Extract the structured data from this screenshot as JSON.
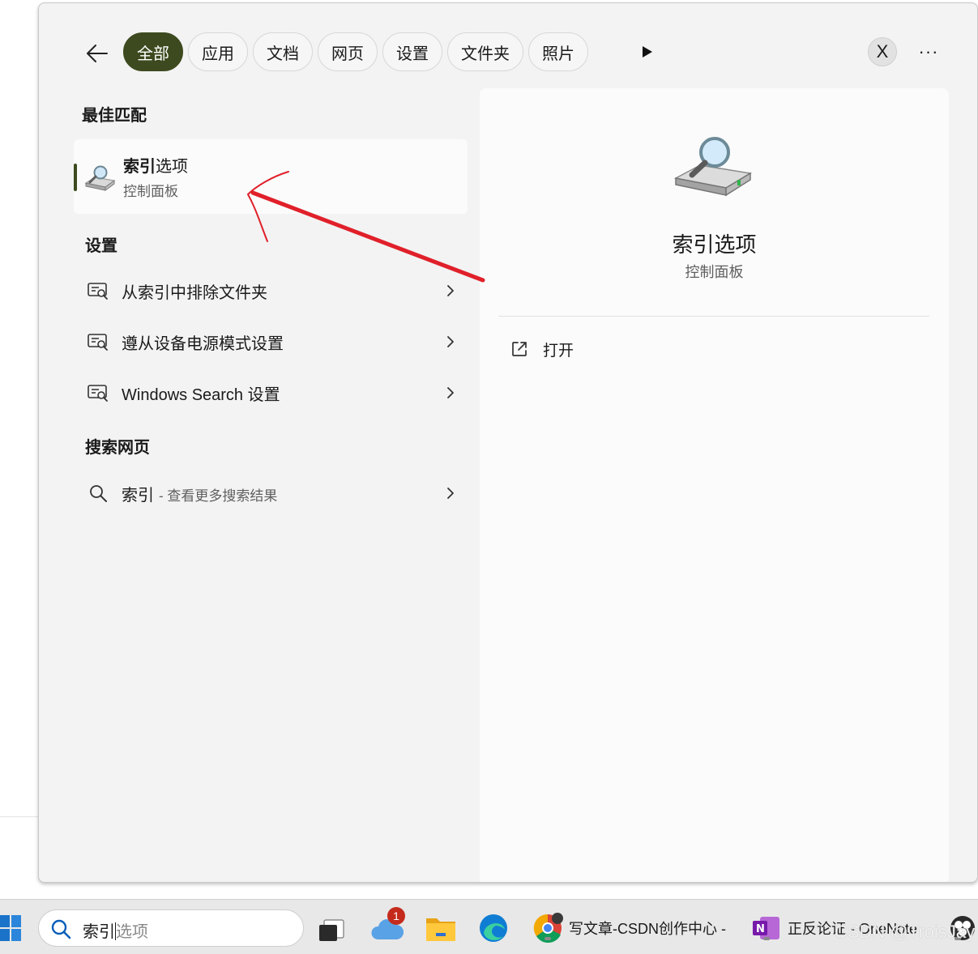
{
  "filters": {
    "chips": [
      "全部",
      "应用",
      "文档",
      "网页",
      "设置",
      "文件夹",
      "照片"
    ],
    "active_index": 0,
    "avatar_letter": "X",
    "more": "···"
  },
  "best_match": {
    "heading": "最佳匹配",
    "title_bold": "索引",
    "title_rest": "选项",
    "subtitle": "控制面板"
  },
  "settings": {
    "heading": "设置",
    "items": [
      {
        "label": "从索引中排除文件夹"
      },
      {
        "label": "遵从设备电源模式设置"
      },
      {
        "label": "Windows Search 设置"
      }
    ]
  },
  "web": {
    "heading": "搜索网页",
    "query": "索引",
    "hint": "- 查看更多搜索结果"
  },
  "detail": {
    "title": "索引选项",
    "subtitle": "控制面板",
    "action_open": "打开"
  },
  "taskbar": {
    "search_typed": "索引",
    "search_suggest": "选项",
    "cloud_badge": "1",
    "chrome_label": "写文章-CSDN创作中心 -",
    "onenote_label": "正反论证 - OneNote",
    "watermark": "CSDN @TroisJay"
  },
  "colors": {
    "accent": "#3d4a1f",
    "annotation": "#e0202a"
  }
}
